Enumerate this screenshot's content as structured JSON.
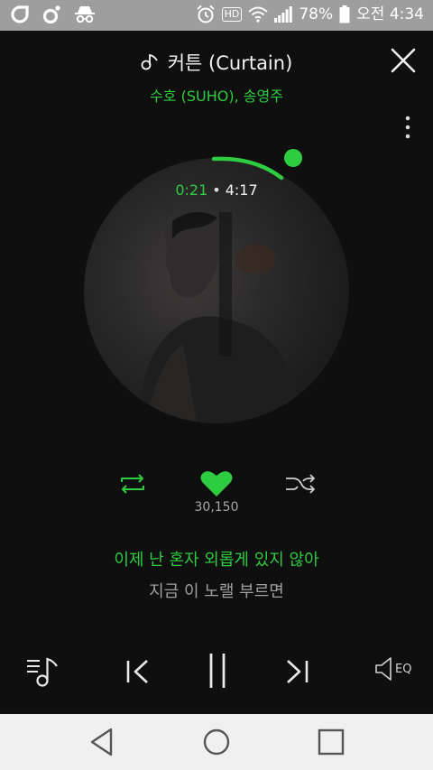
{
  "status_bar": {
    "battery": "78%",
    "time": "오전 4:34",
    "hd_label": "HD",
    "icons": [
      "notification-app-icon",
      "music-app-icon",
      "incognito-icon",
      "alarm-icon",
      "hd-voice-icon",
      "wifi-icon",
      "signal-icon",
      "battery-icon"
    ]
  },
  "track": {
    "title": "커튼 (Curtain)",
    "artist": "수호 (SUHO), 송영주",
    "current_time": "0:21",
    "total_time": "4:17",
    "progress_fraction": 0.082
  },
  "likes": {
    "count": "30,150"
  },
  "lyrics": {
    "current": "이제 난 혼자 외롭게 있지 않아",
    "next": "지금 이 노랠 부르면"
  },
  "eq_label": "EQ",
  "colors": {
    "accent": "#2ecc40",
    "status_bar": "#9e9e9e",
    "background": "#0f0f0f",
    "nav_bar": "#f0f0f0"
  }
}
